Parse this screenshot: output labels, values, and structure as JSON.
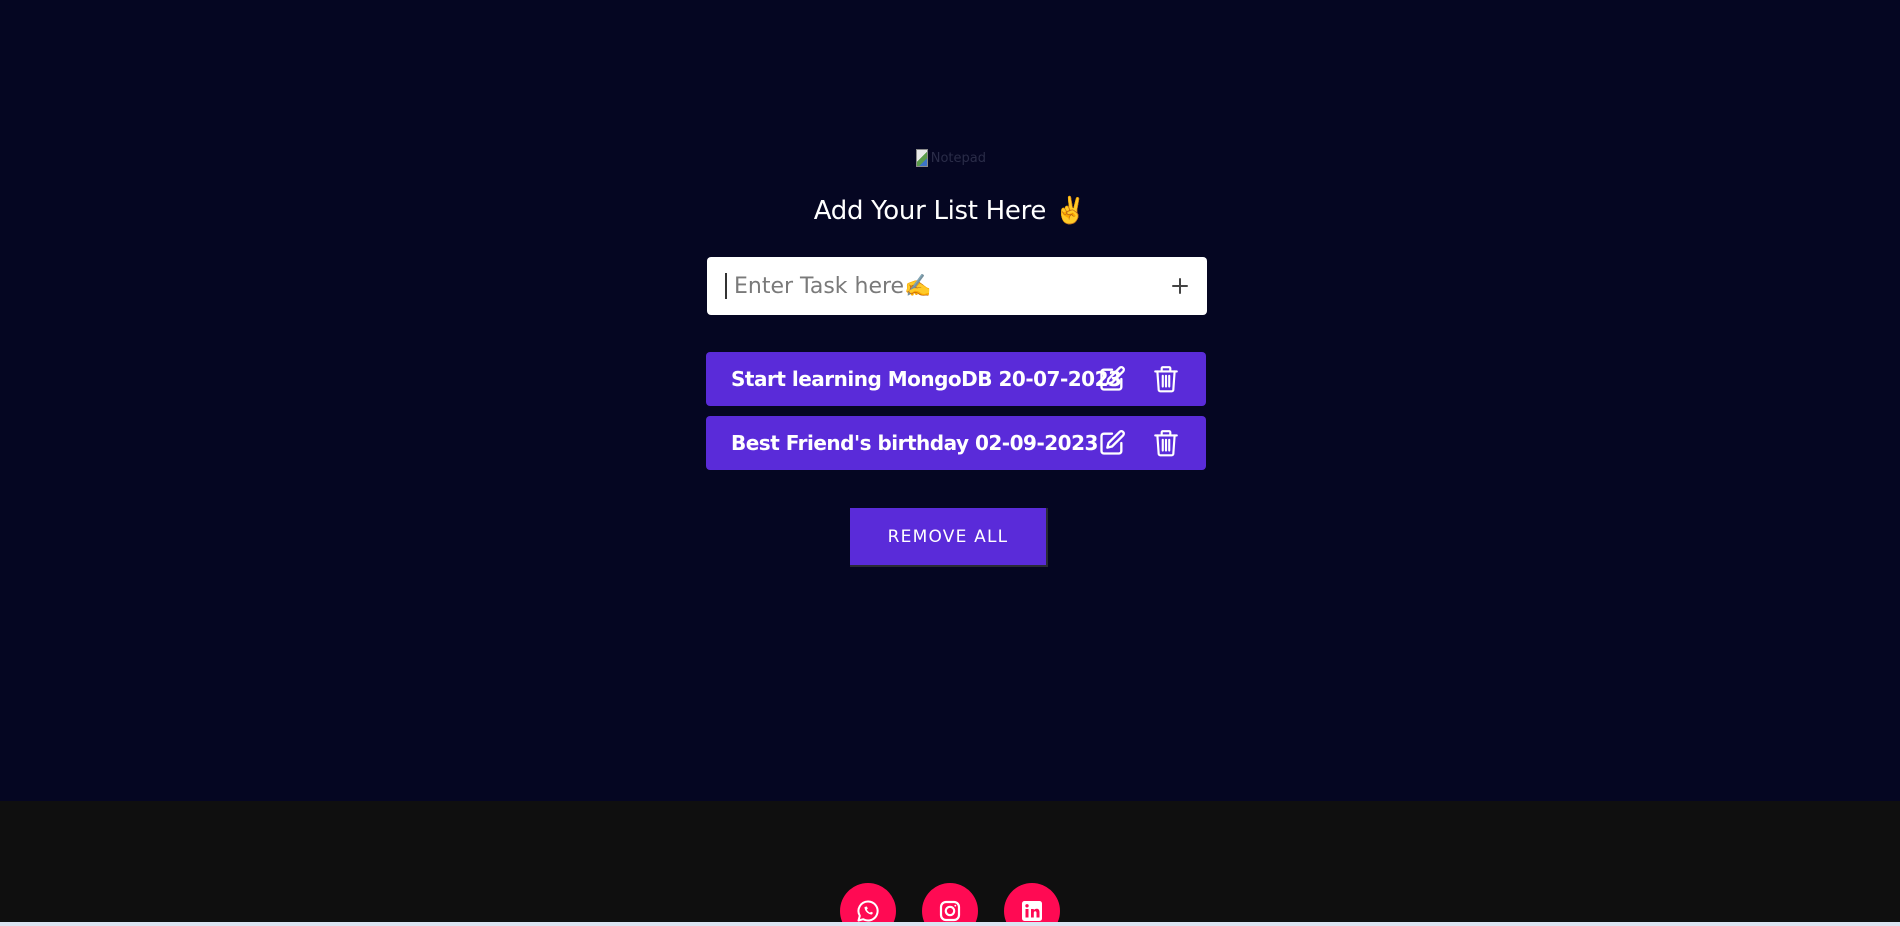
{
  "logo": {
    "alt_text": "Notepad"
  },
  "heading": {
    "text": "Add Your List Here",
    "emoji": "✌️"
  },
  "task_input": {
    "value": "",
    "placeholder": "Enter Task here✍️",
    "add_icon": "plus-icon"
  },
  "tasks": [
    {
      "label": "Start learning MongoDB 20-07-2023",
      "edit_icon": "edit-icon",
      "delete_icon": "trash-icon"
    },
    {
      "label": "Best Friend's birthday 02-09-2023",
      "edit_icon": "edit-icon",
      "delete_icon": "trash-icon"
    }
  ],
  "remove_all": {
    "label": "REMOVE ALL"
  },
  "footer": {
    "socials": [
      {
        "name": "whatsapp",
        "icon": "whatsapp-icon"
      },
      {
        "name": "instagram",
        "icon": "instagram-icon"
      },
      {
        "name": "linkedin",
        "icon": "linkedin-icon"
      }
    ]
  },
  "colors": {
    "background": "#050622",
    "accent": "#5a2bd9",
    "footer": "#0f0f0f",
    "social": "#ff0a53"
  }
}
